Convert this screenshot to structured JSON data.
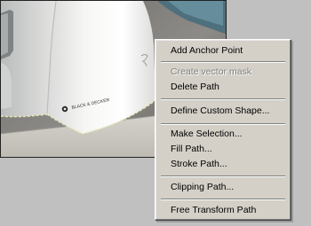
{
  "photo": {
    "brand_label": "BLACK & DECKER"
  },
  "context_menu": {
    "items": [
      {
        "label": "Add Anchor Point",
        "enabled": true
      },
      {
        "label": "Create vector mask",
        "enabled": false
      },
      {
        "label": "Delete Path",
        "enabled": true
      },
      {
        "label": "Define Custom Shape...",
        "enabled": true
      },
      {
        "label": "Make Selection...",
        "enabled": true
      },
      {
        "label": "Fill Path...",
        "enabled": true
      },
      {
        "label": "Stroke Path...",
        "enabled": true
      },
      {
        "label": "Clipping Path...",
        "enabled": true
      },
      {
        "label": "Free Transform Path",
        "enabled": true
      }
    ]
  }
}
